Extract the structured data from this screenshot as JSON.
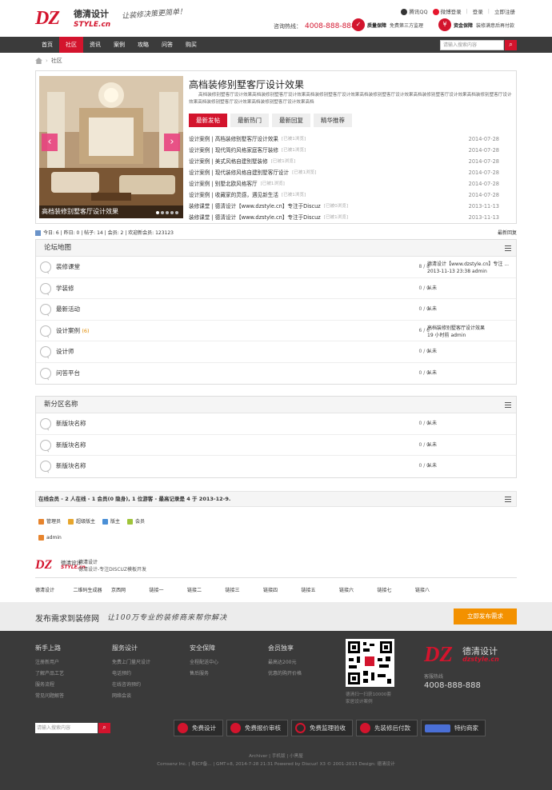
{
  "header": {
    "logo_dz": "DZ",
    "logo_cn": "德清设计",
    "logo_en": "STYLE.cn",
    "slogan": "让装修决策更简单！",
    "links": [
      "腾讯QQ",
      "微博登录",
      "登录",
      "立即注册"
    ],
    "hotline_label": "咨询热线：",
    "hotline": "4008-888-888",
    "promise1_title": "质量保障",
    "promise1_text": "免费第三方监理",
    "promise2_title": "资金保障",
    "promise2_text": "装修满意后再付款"
  },
  "nav": {
    "items": [
      "首页",
      "社区",
      "资讯",
      "案例",
      "攻略",
      "问答",
      "购买"
    ],
    "active_index": 1,
    "search_placeholder": "请输入搜索内容"
  },
  "breadcrumb": {
    "current": "社区"
  },
  "feature": {
    "slide_caption": "高档装修别墅客厅设计效果",
    "title": "高档装修别墅客厅设计效果",
    "desc": "高档装修别墅客厅设计效果高档装修别墅客厅设计效果高档装修别墅客厅设计效果高档装修别墅客厅设计效果高档装修别墅客厅设计效果高档装修别墅客厅设计效果高档装修别墅客厅设计效果高档装修别墅客厅设计效果高档",
    "tabs": [
      "最新发帖",
      "最新热门",
      "最新回复",
      "精华推荐"
    ],
    "threads": [
      {
        "title": "设计案例 | 高档装修别墅客厅设计效果",
        "tag": "[已被1浏览]",
        "date": "2014-07-28"
      },
      {
        "title": "设计案例 | 现代简约风格家庭客厅装修",
        "tag": "[已被1浏览]",
        "date": "2014-07-28"
      },
      {
        "title": "设计案例 | 美式风格自建别墅装修",
        "tag": "[已被1浏览]",
        "date": "2014-07-28"
      },
      {
        "title": "设计案例 | 现代装修风格自建别墅客厅设计",
        "tag": "[已被1浏览]",
        "date": "2014-07-28"
      },
      {
        "title": "设计案例 | 别墅北欧风格客厅",
        "tag": "[已被1浏览]",
        "date": "2014-07-28"
      },
      {
        "title": "设计案例 | 收藏家的灵感，遇见新生活",
        "tag": "[已被1浏览]",
        "date": "2014-07-28"
      },
      {
        "title": "装修课堂 | 德清设计【www.dzstyle.cn】专注于Discuz",
        "tag": "[已被0浏览]",
        "date": "2013-11-13"
      },
      {
        "title": "装修课堂 | 德清设计【www.dzstyle.cn】专注于Discuz",
        "tag": "[已被1浏览]",
        "date": "2013-11-13"
      }
    ]
  },
  "stats": {
    "text": "今日: 6 | 昨日: 0 | 帖子: 14 | 会员: 2 | 欢迎新会员: 123123",
    "right": "最新回复"
  },
  "groups": [
    {
      "name": "论坛地图",
      "forums": [
        {
          "name": "装修课堂",
          "count": "",
          "stat": "8 / 8",
          "last": "德清设计【www.dzstyle.cn】专注 ...",
          "last2": "2013-11-13 23:38 admin"
        },
        {
          "name": "学装修",
          "count": "",
          "stat": "0 / 0",
          "last": "从未",
          "last2": ""
        },
        {
          "name": "最新活动",
          "count": "",
          "stat": "0 / 0",
          "last": "从未",
          "last2": ""
        },
        {
          "name": "设计案例",
          "count": "(6)",
          "stat": "6 / 6",
          "last": "高档装修别墅客厅设计效果",
          "last2": "19 小时前 admin"
        },
        {
          "name": "设计师",
          "count": "",
          "stat": "0 / 0",
          "last": "从未",
          "last2": ""
        },
        {
          "name": "问答平台",
          "count": "",
          "stat": "0 / 0",
          "last": "从未",
          "last2": ""
        }
      ]
    },
    {
      "name": "新分区名称",
      "forums": [
        {
          "name": "新版块名称",
          "count": "",
          "stat": "0 / 0",
          "last": "从未",
          "last2": ""
        },
        {
          "name": "新版块名称",
          "count": "",
          "stat": "0 / 0",
          "last": "从未",
          "last2": ""
        },
        {
          "name": "新版块名称",
          "count": "",
          "stat": "0 / 0",
          "last": "从未",
          "last2": ""
        }
      ]
    }
  ],
  "online": {
    "text": "在线会员 - 2 人在线 - 1 会员(0 隐身), 1 位游客 - 最高记录是 4 于 2013-12-9.",
    "legend": [
      {
        "label": "管理员",
        "color": "#e7842d"
      },
      {
        "label": "超级版主",
        "color": "#e7a62d"
      },
      {
        "label": "版主",
        "color": "#4a8fd6"
      },
      {
        "label": "会员",
        "color": "#9fc43a"
      }
    ],
    "user": "admin"
  },
  "footer_site": {
    "logo_dz": "DZ",
    "logo_cn": "德清设计",
    "logo_en": "STYLE.cn",
    "name": "德清设计",
    "sub": "德清设计-专注DISCUZ模板开发"
  },
  "friend_links": [
    "德清设计",
    "二维码生成器",
    "京西网",
    "链接一",
    "链接二",
    "链接三",
    "链接四",
    "链接五",
    "链接六",
    "链接七",
    "链接八"
  ],
  "banner": {
    "text": "发布需求到装修网",
    "slogan": "让100万专业的装修商来帮你解决",
    "button": "立即发布需求"
  },
  "dark_footer": {
    "cols": [
      {
        "title": "新手上路",
        "items": [
          "注册新用户",
          "了解产品工艺",
          "服务流程",
          "常见问题解答"
        ]
      },
      {
        "title": "服务设计",
        "items": [
          "免费上门量尺设计",
          "电话预约",
          "在线咨询预约",
          "网络会谈"
        ]
      },
      {
        "title": "安全保障",
        "items": [
          "全程配送中心",
          "售后服务"
        ]
      },
      {
        "title": "会员独享",
        "items": [
          "最高达200元",
          "优惠的购开价格"
        ]
      }
    ],
    "qr_caption1": "德清扫一扫获10000套",
    "qr_caption2": "家居设计案例",
    "logo_dz": "DZ",
    "logo_cn": "德清设计",
    "logo_en": "dzstyle.cn",
    "hotline_label": "客服热线",
    "phone": "4008-888-888",
    "search_placeholder": "请输入搜索内容",
    "buttons": [
      "免费设计",
      "免费报价审核",
      "免费监理验收",
      "先装修后付款",
      "特约商家"
    ],
    "bottom_links": "Archiver | 手机版 | 小黑屋",
    "copyright": "Comsenz Inc. | 粤ICP备... | GMT+8, 2014-7-28 21:31 Powered by Discuz! X3 © 2001-2013 Design: 德清设计"
  }
}
